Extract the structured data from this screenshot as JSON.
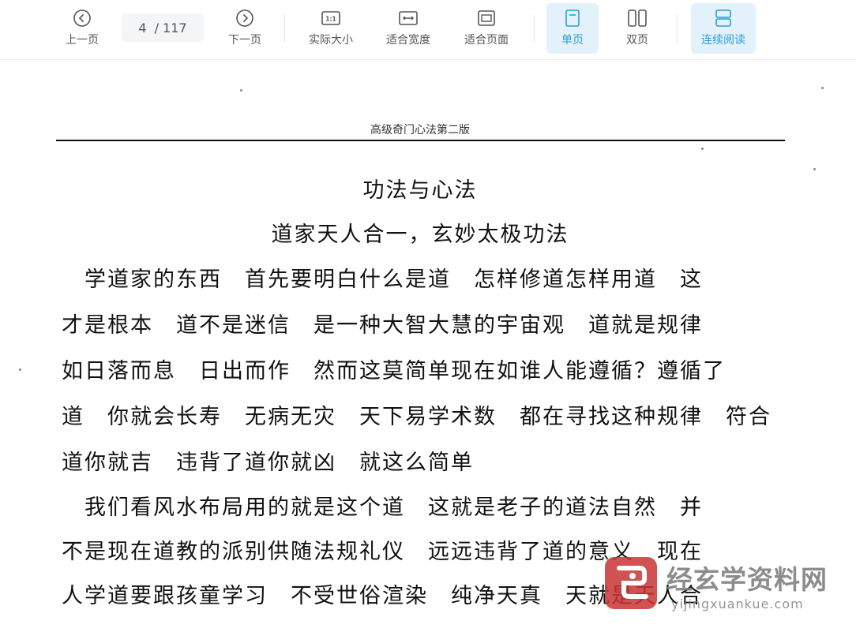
{
  "toolbar": {
    "prev_label": "上一页",
    "page_current": "4",
    "page_total": "/ 117",
    "next_label": "下一页",
    "actual_size_label": "实际大小",
    "fit_width_label": "适合宽度",
    "fit_page_label": "适合页面",
    "single_page_label": "单页",
    "double_page_label": "双页",
    "continuous_label": "连续阅读",
    "accent_color": "#2a9fd6",
    "active_bg": "#e3f1fb"
  },
  "document": {
    "header": "高级奇门心法第二版",
    "title": "功法与心法",
    "subtitle": "道家天人合一，玄妙太极功法",
    "lines": [
      "　学道家的东西　首先要明白什么是道　怎样修道怎样用道　这",
      "才是根本　道不是迷信　是一种大智大慧的宇宙观　道就是规律",
      "如日落而息　日出而作　然而这莫简单现在如谁人能遵循？遵循了",
      "道　你就会长寿　无病无灾　天下易学术数　都在寻找这种规律　符合",
      "道你就吉　违背了道你就凶　就这么简单",
      "　我们看风水布局用的就是这个道　这就是老子的道法自然　并",
      "不是现在道教的派别供随法规礼仪　远远违背了道的意义　现在",
      "人学道要跟孩童学习　不受世俗渲染　纯净天真　天就是天人合"
    ]
  },
  "watermark": {
    "name": "经玄学资料网",
    "url": "yijingxuankue.com",
    "logo_color": "#c83434"
  }
}
